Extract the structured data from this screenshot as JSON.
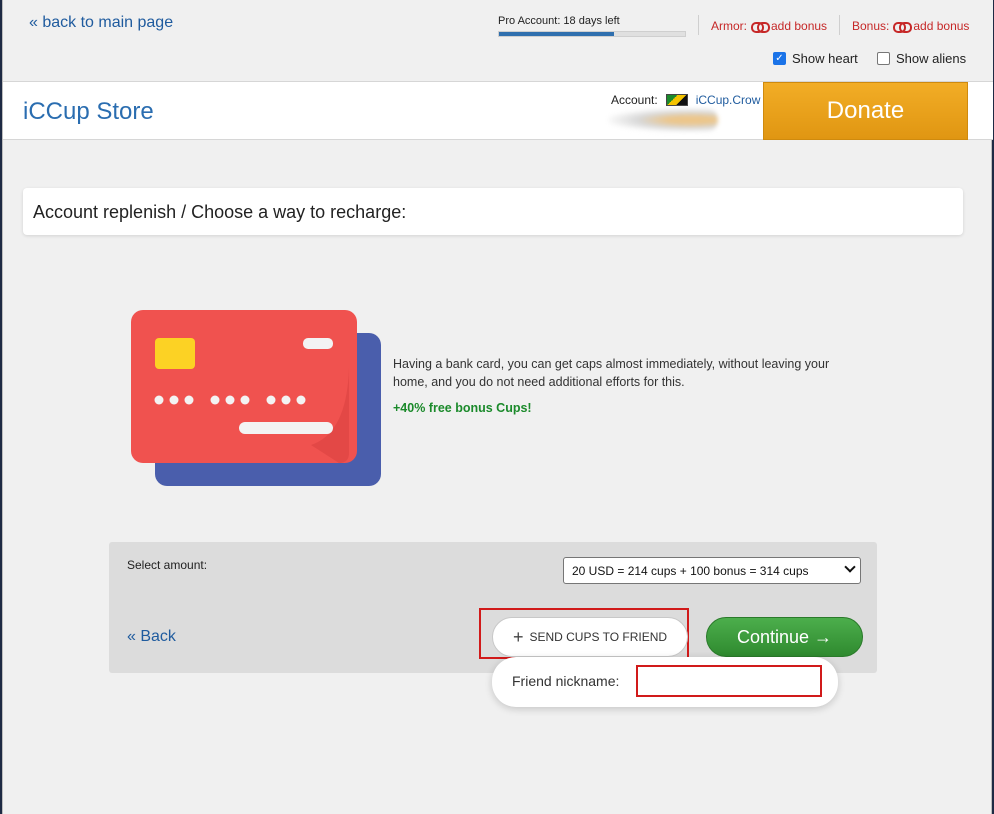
{
  "topbar": {
    "back_main": "« back to main page",
    "pro_account": "Pro Account: 18 days left",
    "pro_progress_fraction": 0.62,
    "armor_label": "Armor:",
    "armor_link": "add bonus",
    "bonus_label": "Bonus:",
    "bonus_link": "add bonus",
    "show_heart": "Show heart",
    "show_heart_checked": true,
    "show_aliens": "Show aliens",
    "show_aliens_checked": false
  },
  "header": {
    "title": "iCCup Store",
    "account_label": "Account:",
    "account_name": "iCCup.Crow",
    "donate": "Donate"
  },
  "main": {
    "panel_title": "Account replenish / Choose a way to recharge:",
    "description": "Having a bank card, you can get caps almost immediately, without leaving your home, and you do not need additional efforts for this.",
    "bonus": "+40% free bonus Cups!",
    "select_label": "Select amount:",
    "select_value": "20 USD = 214 cups + 100 bonus = 314 cups",
    "back": "« Back",
    "send_cups": "SEND CUPS TO FRIEND",
    "continue": "Continue →",
    "friend_label": "Friend nickname:",
    "friend_value": ""
  },
  "colors": {
    "link_blue": "#1f5b9e",
    "title_blue": "#2a6db0",
    "donate_orange": "#f2ad26",
    "continue_green": "#3c9d3c",
    "bonus_green": "#1b8a2b",
    "alert_red": "#c62828",
    "card_red": "#f0524f",
    "card_blue": "#4a5eac",
    "chip_yellow": "#fcd224"
  }
}
